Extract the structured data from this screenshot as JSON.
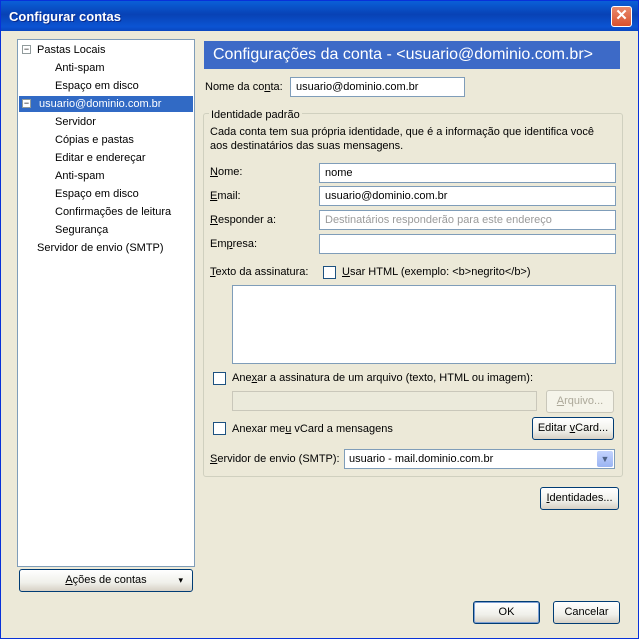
{
  "window": {
    "title": "Configurar contas",
    "close": "✕"
  },
  "tree": {
    "items": [
      {
        "label": "Pastas Locais",
        "expander": "−"
      },
      {
        "label": "Anti-spam"
      },
      {
        "label": "Espaço em disco"
      },
      {
        "label": "usuario@dominio.com.br",
        "expander": "−"
      },
      {
        "label": "Servidor"
      },
      {
        "label": "Cópias e pastas"
      },
      {
        "label": "Editar e endereçar"
      },
      {
        "label": "Anti-spam"
      },
      {
        "label": "Espaço em disco"
      },
      {
        "label": "Confirmações de leitura"
      },
      {
        "label": "Segurança"
      },
      {
        "label": "Servidor de envio (SMTP)"
      }
    ]
  },
  "account_actions": {
    "label_u": "A",
    "label_rest": "ções de contas",
    "arrow": "▾"
  },
  "header": {
    "title": "Configurações da conta - <usuario@dominio.com.br>"
  },
  "account_name": {
    "label_pre": "Nome da co",
    "label_u": "n",
    "label_post": "ta:",
    "value": "usuario@dominio.com.br"
  },
  "identity": {
    "group_title": "Identidade padrão",
    "description": "Cada conta tem sua própria identidade, que é a informação que identifica você aos destinatários das suas mensagens.",
    "name": {
      "label_u": "N",
      "label_rest": "ome:",
      "value": "nome"
    },
    "email": {
      "label_u": "E",
      "label_rest": "mail:",
      "value": "usuario@dominio.com.br"
    },
    "reply_to": {
      "label_u": "R",
      "label_rest": "esponder a:",
      "placeholder": "Destinatários responderão para este endereço"
    },
    "company": {
      "label_pre": "Em",
      "label_u": "p",
      "label_post": "resa:"
    },
    "signature": {
      "label_u": "T",
      "label_rest": "exto da assinatura:",
      "html_label_u": "U",
      "html_label_rest": "sar HTML (exemplo: <b>negrito</b>)",
      "value": ""
    },
    "attach_signature": {
      "label_pre": "Ane",
      "label_u": "x",
      "label_post": "ar a assinatura de um arquivo (texto, HTML ou imagem):"
    },
    "file_button": {
      "label_u": "A",
      "label_rest": "rquivo..."
    },
    "attach_vcard": {
      "label_pre": "Anexar me",
      "label_u": "u",
      "label_post": " vCard a mensagens"
    },
    "edit_vcard": {
      "label_pre": "Editar ",
      "label_u": "v",
      "label_post": "Card..."
    },
    "smtp": {
      "label_u": "S",
      "label_rest": "ervidor de envio (SMTP):",
      "value": "usuario - mail.dominio.com.br",
      "arrow": "▼"
    }
  },
  "identities_button": {
    "label_u": "I",
    "label_rest": "dentidades..."
  },
  "ok_button": {
    "label": "OK"
  },
  "cancel_button": {
    "label": "Cancelar"
  }
}
